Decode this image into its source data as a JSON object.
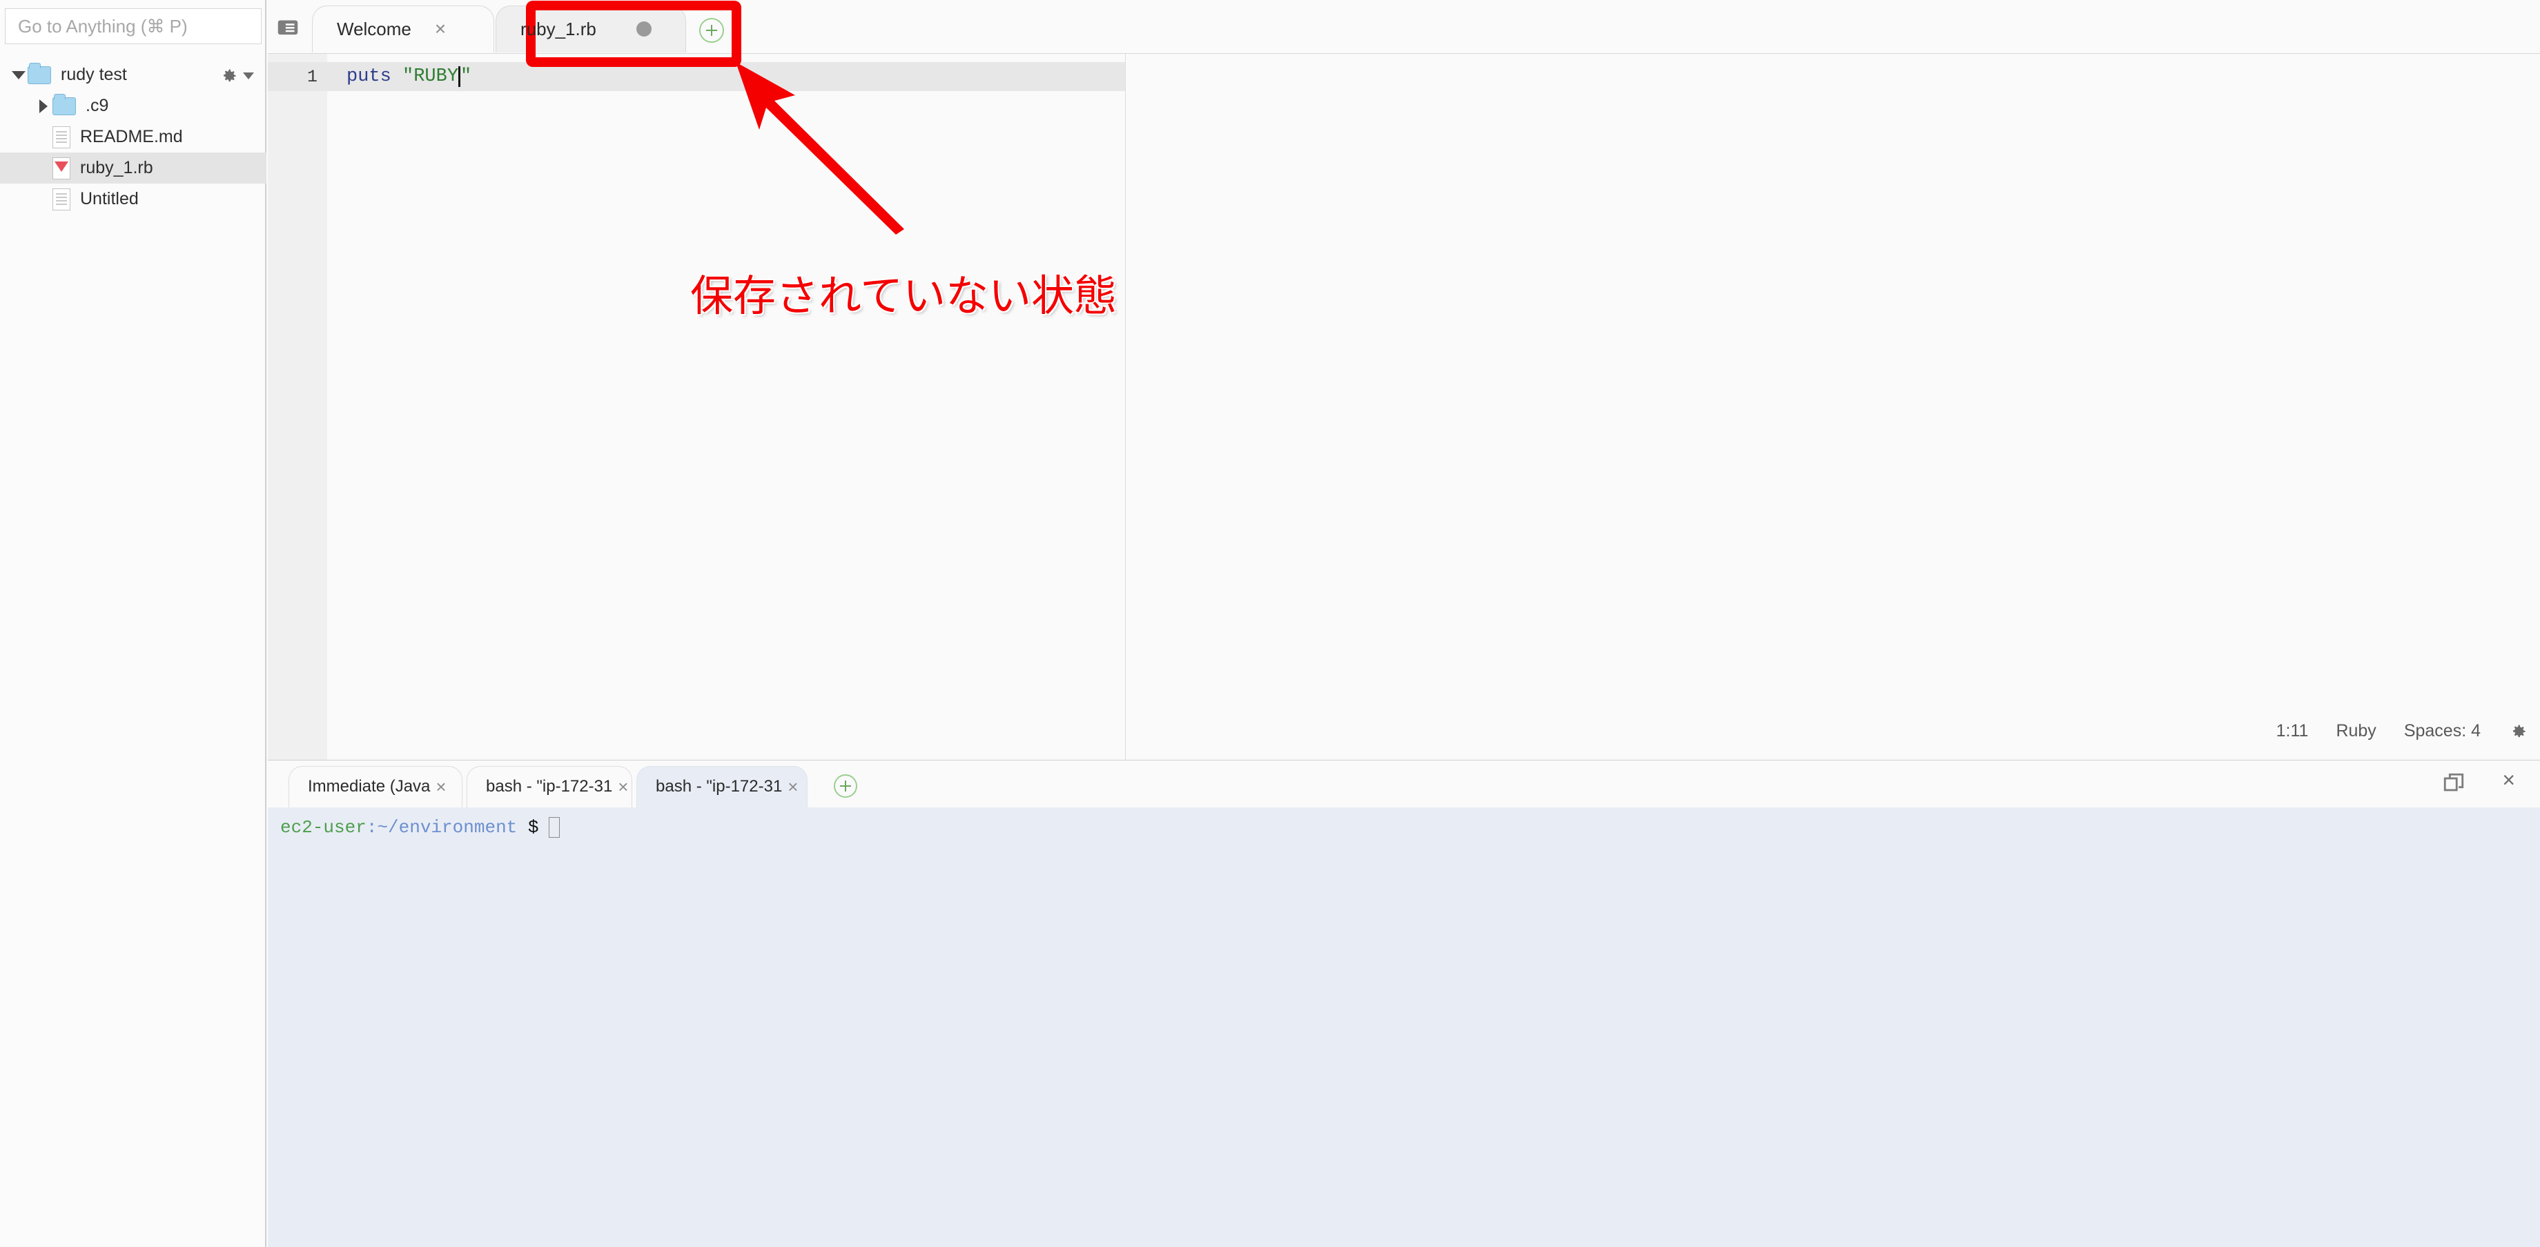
{
  "sidebar": {
    "search": {
      "placeholder": "Go to Anything (⌘ P)",
      "value": ""
    },
    "gear_icon": "gear-icon",
    "tree": [
      {
        "label": "rudy test",
        "icon": "folder-icon",
        "type": "folder",
        "expanded": true,
        "depth": 0,
        "selected": false
      },
      {
        "label": ".c9",
        "icon": "folder-icon",
        "type": "folder",
        "expanded": false,
        "depth": 1,
        "selected": false
      },
      {
        "label": "README.md",
        "icon": "file-icon",
        "type": "file",
        "depth": 1,
        "selected": false
      },
      {
        "label": "ruby_1.rb",
        "icon": "ruby-file-icon",
        "type": "file",
        "depth": 1,
        "selected": true
      },
      {
        "label": "Untitled",
        "icon": "file-icon",
        "type": "file",
        "depth": 1,
        "selected": false
      }
    ]
  },
  "editor": {
    "panel_toggle_icon": "panel-list-icon",
    "tabs": [
      {
        "label": "Welcome",
        "active": false,
        "dirty": false,
        "close_glyph": "×"
      },
      {
        "label": "ruby_1.rb",
        "active": true,
        "dirty": true,
        "close_glyph": "×"
      }
    ],
    "add_tab_icon": "plus-circle-icon",
    "line_numbers": [
      "1"
    ],
    "code": {
      "keyword": "puts",
      "space": " ",
      "string": "\"RUBY",
      "string_tail": "\""
    },
    "status": {
      "cursor": "1:11",
      "language": "Ruby",
      "indent": "Spaces: 4",
      "gear_icon": "gear-icon"
    }
  },
  "terminal": {
    "tabs": [
      {
        "label": "Immediate (Java",
        "active": false,
        "close_glyph": "×"
      },
      {
        "label": "bash - \"ip-172-31",
        "active": false,
        "close_glyph": "×"
      },
      {
        "label": "bash - \"ip-172-31",
        "active": true,
        "close_glyph": "×"
      }
    ],
    "add_tab_icon": "plus-circle-icon",
    "maximize_icon": "restore-window-icon",
    "close_icon": "×",
    "prompt": {
      "user": "ec2-user",
      "colon": ":",
      "path": "~/environment",
      "dollar": "$"
    }
  },
  "annotations": {
    "box_color": "#f40000",
    "arrow_color": "#f40000",
    "text": "保存されていない状態",
    "text_color": "#f40000"
  }
}
